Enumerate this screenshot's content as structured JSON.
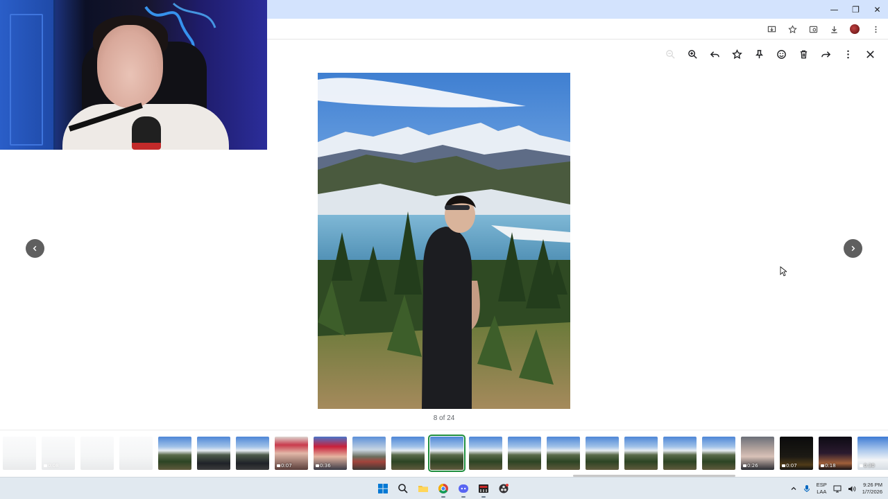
{
  "viewer": {
    "counter": "8 of 24",
    "tools": [
      "zoom-out",
      "zoom-in",
      "reply",
      "favorite",
      "pin",
      "emoji-react",
      "delete",
      "forward",
      "more",
      "close"
    ]
  },
  "filmstrip": {
    "selected_index": 11,
    "thumbs": [
      {
        "kind": "photo",
        "scene": "snow",
        "faded": true,
        "duration": ""
      },
      {
        "kind": "video",
        "scene": "snow",
        "faded": true,
        "duration": "0:08"
      },
      {
        "kind": "photo",
        "scene": "snow",
        "faded": true,
        "duration": ""
      },
      {
        "kind": "photo",
        "scene": "snow",
        "faded": true,
        "duration": ""
      },
      {
        "kind": "photo",
        "scene": "mountain",
        "faded": false,
        "duration": ""
      },
      {
        "kind": "photo",
        "scene": "mountain-car",
        "faded": false,
        "duration": ""
      },
      {
        "kind": "photo",
        "scene": "mountain-car",
        "faded": false,
        "duration": ""
      },
      {
        "kind": "video",
        "scene": "selfie-duo",
        "faded": false,
        "duration": "0:07"
      },
      {
        "kind": "video",
        "scene": "selfie-red",
        "faded": false,
        "duration": "0:36"
      },
      {
        "kind": "photo",
        "scene": "mountain-duo",
        "faded": false,
        "duration": ""
      },
      {
        "kind": "photo",
        "scene": "mountain",
        "faded": false,
        "duration": ""
      },
      {
        "kind": "photo",
        "scene": "mountain",
        "faded": false,
        "duration": ""
      },
      {
        "kind": "photo",
        "scene": "mountain",
        "faded": false,
        "duration": ""
      },
      {
        "kind": "photo",
        "scene": "mountain",
        "faded": false,
        "duration": ""
      },
      {
        "kind": "photo",
        "scene": "mountain",
        "faded": false,
        "duration": ""
      },
      {
        "kind": "photo",
        "scene": "mountain",
        "faded": false,
        "duration": ""
      },
      {
        "kind": "photo",
        "scene": "mountain",
        "faded": false,
        "duration": ""
      },
      {
        "kind": "photo",
        "scene": "mountain",
        "faded": false,
        "duration": ""
      },
      {
        "kind": "photo",
        "scene": "mountain",
        "faded": false,
        "duration": ""
      },
      {
        "kind": "video",
        "scene": "face-dark",
        "faded": false,
        "duration": "0:26"
      },
      {
        "kind": "video",
        "scene": "night",
        "faded": false,
        "duration": "0:07"
      },
      {
        "kind": "video",
        "scene": "night-lights",
        "faded": false,
        "duration": "0:18"
      },
      {
        "kind": "video",
        "scene": "snow-blue",
        "faded": false,
        "duration": "0:30"
      }
    ]
  },
  "taskbar": {
    "lang": "ESP",
    "layout": "LAA",
    "time": "9:26 PM",
    "date": "1/7/2026"
  },
  "colors": {
    "selected_outline": "#1e8e3e",
    "titlebar": "#d3e3fd",
    "nav_arrow": "#5f5f5f"
  }
}
